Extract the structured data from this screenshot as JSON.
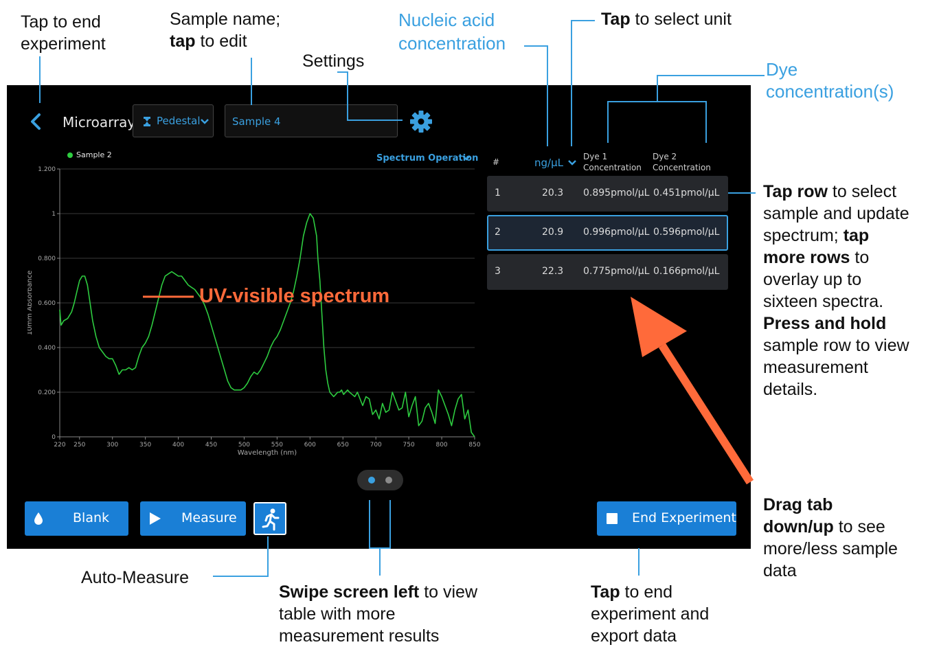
{
  "annotations": {
    "end_experiment_hint": [
      "Tap to end",
      "experiment"
    ],
    "sample_name_hint_line1": "Sample name;",
    "sample_name_hint_bold": "tap",
    "sample_name_hint_rest": " to edit",
    "settings": "Settings",
    "nucleic_acid": [
      "Nucleic acid",
      "concentration"
    ],
    "select_unit_bold": "Tap",
    "select_unit_rest": " to select unit",
    "dye_conc": [
      "Dye",
      "concentration(s)"
    ],
    "uv_spectrum": "UV-visible spectrum",
    "tap_row_lines": [
      [
        {
          "t": "Tap row",
          "b": true
        },
        {
          "t": " to select",
          "b": false
        }
      ],
      [
        {
          "t": "sample and update",
          "b": false
        }
      ],
      [
        {
          "t": "spectrum; ",
          "b": false
        },
        {
          "t": "tap",
          "b": true
        }
      ],
      [
        {
          "t": "more rows",
          "b": true
        },
        {
          "t": " to",
          "b": false
        }
      ],
      [
        {
          "t": "overlay up to",
          "b": false
        }
      ],
      [
        {
          "t": "sixteen spectra.",
          "b": false
        }
      ],
      [
        {
          "t": "Press and hold",
          "b": true
        }
      ],
      [
        {
          "t": "sample row to view",
          "b": false
        }
      ],
      [
        {
          "t": "measurement",
          "b": false
        }
      ],
      [
        {
          "t": "details.",
          "b": false
        }
      ]
    ],
    "drag_tab_lines": [
      [
        {
          "t": "Drag tab",
          "b": true
        }
      ],
      [
        {
          "t": "down/up",
          "b": true
        },
        {
          "t": " to see",
          "b": false
        }
      ],
      [
        {
          "t": "more/less sample",
          "b": false
        }
      ],
      [
        {
          "t": "data",
          "b": false
        }
      ]
    ],
    "auto_measure": "Auto-Measure",
    "swipe_lines": [
      [
        {
          "t": "Swipe screen left",
          "b": true
        },
        {
          "t": " to view",
          "b": false
        }
      ],
      [
        {
          "t": "table with more",
          "b": false
        }
      ],
      [
        {
          "t": "measurement results",
          "b": false
        }
      ]
    ],
    "export_lines": [
      [
        {
          "t": "Tap",
          "b": true
        },
        {
          "t": " to end",
          "b": false
        }
      ],
      [
        {
          "t": "experiment and",
          "b": false
        }
      ],
      [
        {
          "t": "export data",
          "b": false
        }
      ]
    ]
  },
  "header": {
    "app_name": "Microarray",
    "pedestal_label": "Pedestal",
    "sample_name": "Sample 4",
    "settings_icon": "gear-icon",
    "back_icon": "chevron-left-icon"
  },
  "chart_header": {
    "legend_label": "Sample 2",
    "spectrum_operation": "Spectrum Operation"
  },
  "chart_data": {
    "type": "line",
    "xlabel": "Wavelength (nm)",
    "ylabel": "10mm Absorbance",
    "xlim": [
      220,
      850
    ],
    "ylim": [
      0,
      1.2
    ],
    "xticks": [
      220,
      250,
      300,
      350,
      400,
      450,
      500,
      550,
      600,
      650,
      700,
      750,
      800,
      850
    ],
    "ytick_values": [
      0,
      0.2,
      0.4,
      0.6,
      0.8,
      1,
      1.2
    ],
    "ytick_labels": [
      "0",
      "0.200",
      "0.400",
      "0.600",
      "0.800",
      "1",
      "1.200"
    ],
    "grid": true,
    "color": "#2ecc40",
    "series": [
      {
        "name": "Sample 2",
        "x": [
          220,
          222,
          226,
          232,
          238,
          242,
          246,
          250,
          254,
          258,
          262,
          266,
          270,
          275,
          280,
          285,
          290,
          295,
          300,
          305,
          310,
          315,
          320,
          325,
          330,
          335,
          340,
          345,
          350,
          355,
          360,
          365,
          370,
          375,
          380,
          385,
          390,
          395,
          400,
          405,
          410,
          415,
          420,
          425,
          430,
          435,
          440,
          445,
          450,
          455,
          460,
          465,
          470,
          475,
          480,
          485,
          490,
          495,
          500,
          505,
          510,
          515,
          520,
          525,
          530,
          535,
          540,
          545,
          550,
          555,
          560,
          565,
          570,
          575,
          580,
          585,
          590,
          595,
          600,
          605,
          610,
          612,
          615,
          618,
          621,
          624,
          627,
          630,
          633,
          636,
          639,
          642,
          645,
          648,
          651,
          654,
          657,
          660,
          664,
          668,
          672,
          676,
          680,
          685,
          690,
          695,
          700,
          705,
          710,
          715,
          720,
          725,
          730,
          735,
          740,
          745,
          750,
          755,
          760,
          765,
          770,
          775,
          780,
          785,
          790,
          795,
          800,
          805,
          810,
          815,
          820,
          825,
          830,
          835,
          840,
          845,
          850
        ],
        "y": [
          0.57,
          0.5,
          0.52,
          0.53,
          0.56,
          0.6,
          0.65,
          0.7,
          0.72,
          0.72,
          0.68,
          0.6,
          0.52,
          0.45,
          0.4,
          0.38,
          0.36,
          0.35,
          0.35,
          0.32,
          0.28,
          0.3,
          0.3,
          0.31,
          0.3,
          0.31,
          0.36,
          0.4,
          0.42,
          0.45,
          0.5,
          0.56,
          0.62,
          0.68,
          0.72,
          0.73,
          0.74,
          0.73,
          0.72,
          0.72,
          0.7,
          0.68,
          0.67,
          0.66,
          0.64,
          0.62,
          0.59,
          0.55,
          0.5,
          0.45,
          0.4,
          0.35,
          0.3,
          0.25,
          0.22,
          0.21,
          0.21,
          0.21,
          0.22,
          0.24,
          0.27,
          0.29,
          0.28,
          0.3,
          0.33,
          0.36,
          0.4,
          0.43,
          0.45,
          0.48,
          0.52,
          0.56,
          0.6,
          0.65,
          0.72,
          0.8,
          0.9,
          0.96,
          1.0,
          0.98,
          0.9,
          0.8,
          0.7,
          0.55,
          0.4,
          0.3,
          0.24,
          0.2,
          0.19,
          0.18,
          0.19,
          0.2,
          0.2,
          0.21,
          0.19,
          0.2,
          0.21,
          0.2,
          0.19,
          0.18,
          0.2,
          0.17,
          0.14,
          0.18,
          0.17,
          0.1,
          0.12,
          0.08,
          0.15,
          0.11,
          0.12,
          0.2,
          0.16,
          0.12,
          0.13,
          0.2,
          0.09,
          0.14,
          0.18,
          0.05,
          0.07,
          0.13,
          0.15,
          0.11,
          0.06,
          0.21,
          0.18,
          0.14,
          0.1,
          0.05,
          0.12,
          0.17,
          0.19,
          0.08,
          0.12,
          0.02,
          0.0
        ]
      }
    ]
  },
  "table": {
    "headers": {
      "num": "#",
      "unit": "ng/µL",
      "dye1_line1": "Dye 1",
      "dye1_line2": "Concentration",
      "dye2_line1": "Dye 2",
      "dye2_line2": "Concentration"
    },
    "rows": [
      {
        "num": "1",
        "conc": "20.3",
        "dye1": "0.895pmol/µL",
        "dye2": "0.451pmol/µL"
      },
      {
        "num": "2",
        "conc": "20.9",
        "dye1": "0.996pmol/µL",
        "dye2": "0.596pmol/µL"
      },
      {
        "num": "3",
        "conc": "22.3",
        "dye1": "0.775pmol/µL",
        "dye2": "0.166pmol/µL"
      }
    ]
  },
  "buttons": {
    "blank": "Blank",
    "measure": "Measure",
    "end_experiment": "End Experiment"
  },
  "colors": {
    "accent": "#1a7fd6",
    "annotation_blue": "#3aa0e0",
    "highlight_orange": "#ff6a3a",
    "spectrum_green": "#2ecc40"
  }
}
